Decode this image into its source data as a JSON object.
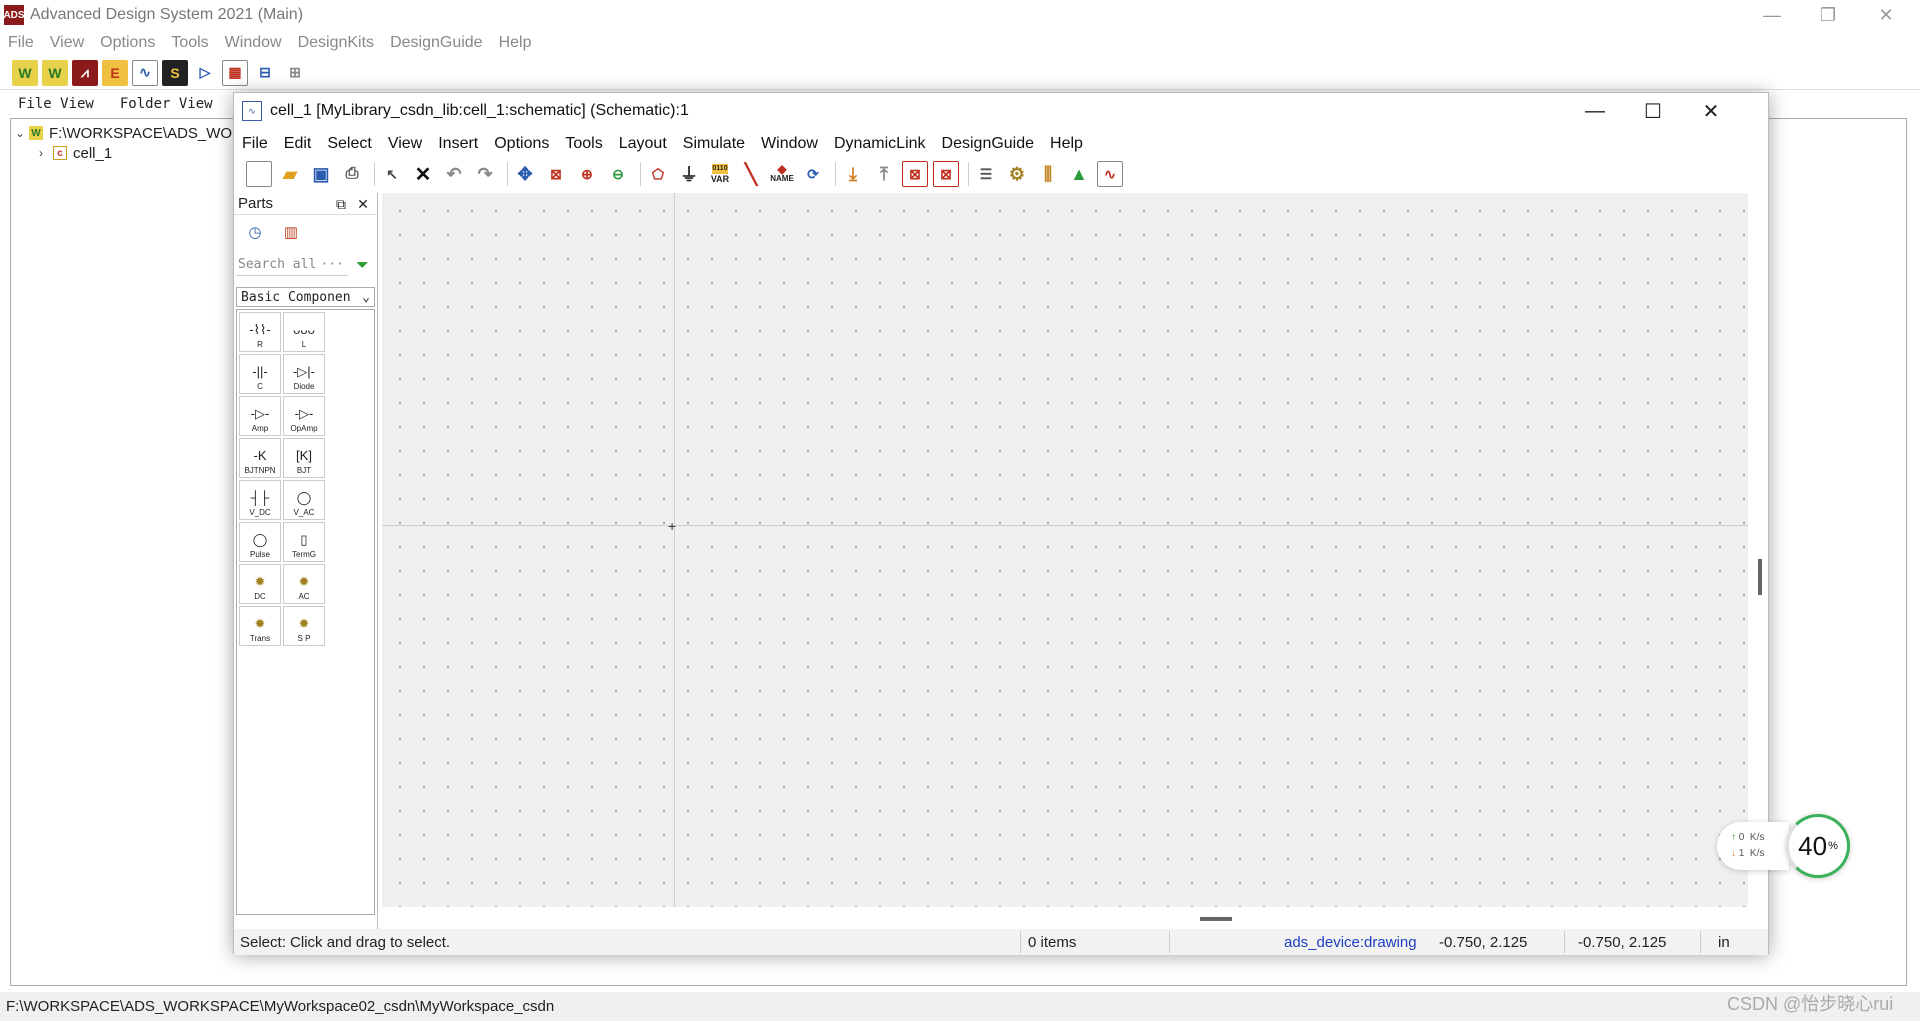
{
  "main_window": {
    "title": "Advanced Design System 2021 (Main)",
    "app_icon": "ADS",
    "menu": [
      "File",
      "View",
      "Options",
      "Tools",
      "Window",
      "DesignKits",
      "DesignGuide",
      "Help"
    ],
    "tabs": [
      "File View",
      "Folder View"
    ],
    "tree": {
      "root": "F:\\WORKSPACE\\ADS_WO",
      "root_icon": "W",
      "child": "cell_1",
      "child_icon": "c"
    },
    "status_path": "F:\\WORKSPACE\\ADS_WORKSPACE\\MyWorkspace02_csdn\\MyWorkspace_csdn"
  },
  "schematic_window": {
    "title": "cell_1 [MyLibrary_csdn_lib:cell_1:schematic] (Schematic):1",
    "menu": [
      "File",
      "Edit",
      "Select",
      "View",
      "Insert",
      "Options",
      "Tools",
      "Layout",
      "Simulate",
      "Window",
      "DynamicLink",
      "DesignGuide",
      "Help"
    ],
    "toolbar_labels": {
      "var": "VAR",
      "name": "NAME"
    },
    "parts": {
      "title": "Parts",
      "search_placeholder": "Search all",
      "search_more": "···",
      "palette": "Basic Componen",
      "items": [
        {
          "label": "R",
          "symbol": "-⌇⌇-"
        },
        {
          "label": "L",
          "symbol": "ᴗᴗᴗ"
        },
        {
          "label": "C",
          "symbol": "-||-"
        },
        {
          "label": "Diode",
          "symbol": "-▷|-"
        },
        {
          "label": "Amp",
          "symbol": "-▷-"
        },
        {
          "label": "OpAmp",
          "symbol": "-▷-"
        },
        {
          "label": "BJTNPN",
          "symbol": "-K"
        },
        {
          "label": "BJT",
          "symbol": "[K]"
        },
        {
          "label": "V_DC",
          "symbol": "┤├"
        },
        {
          "label": "V_AC",
          "symbol": "◯"
        },
        {
          "label": "Pulse",
          "symbol": "◯"
        },
        {
          "label": "TermG",
          "symbol": "▯"
        },
        {
          "label": "DC",
          "symbol": "✹"
        },
        {
          "label": "AC",
          "symbol": "✹"
        },
        {
          "label": "Trans",
          "symbol": "✹"
        },
        {
          "label": "S P",
          "symbol": "✹"
        }
      ]
    },
    "status": {
      "message": "Select: Click and drag to select.",
      "items": "0 items",
      "layer": "ads_device:drawing",
      "coord1": "-0.750, 2.125",
      "coord2": "-0.750, 2.125",
      "unit": "in"
    }
  },
  "net_monitor": {
    "up": "0",
    "down": "1",
    "unit": "K/s",
    "percent": "40",
    "percent_sign": "%"
  },
  "watermark": "CSDN @怡步晓心rui",
  "colors": {
    "accent_blue": "#2a5db0",
    "layer_text": "#1f3fbf",
    "canvas_bg": "#f0efed"
  }
}
